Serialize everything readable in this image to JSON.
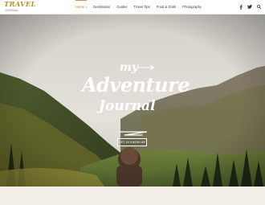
{
  "logo": {
    "main": "TRAVEL",
    "sub": "JOURNAL"
  },
  "nav": {
    "items": [
      {
        "label": "Home",
        "active": true,
        "has_caret": true
      },
      {
        "label": "Destination",
        "active": false,
        "has_caret": false
      },
      {
        "label": "Guides",
        "active": false,
        "has_caret": false
      },
      {
        "label": "Travel Tips",
        "active": false,
        "has_caret": false
      },
      {
        "label": "Food & Drink",
        "active": false,
        "has_caret": false
      },
      {
        "label": "Photography",
        "active": false,
        "has_caret": false
      }
    ],
    "caret": "▾"
  },
  "header_icons": [
    "facebook-icon",
    "twitter-icon",
    "search-icon"
  ],
  "hero": {
    "title_line1": "my",
    "title_line2": "Adventure",
    "title_line3": "Journal",
    "cta_label": "GET IN KNOW ME"
  },
  "colors": {
    "accent": "#c69a45",
    "header_bg": "#ffffff",
    "footer_bg": "#f3eee8"
  }
}
